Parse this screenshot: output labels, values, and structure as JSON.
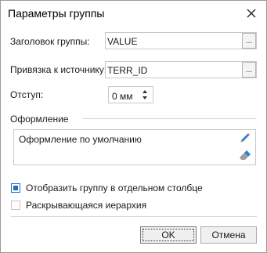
{
  "window": {
    "title": "Параметры группы"
  },
  "form": {
    "group_header": {
      "label": "Заголовок группы:",
      "value": "VALUE",
      "button": "..."
    },
    "source_binding": {
      "label": "Привязка к источнику:",
      "value": "TERR_ID",
      "button": "..."
    },
    "indent": {
      "label": "Отступ:",
      "value": "0 мм"
    },
    "design": {
      "group_label": "Оформление",
      "value": "Оформление по умолчанию",
      "edit_icon": "pencil-icon",
      "clear_icon": "eraser-icon"
    },
    "checkboxes": [
      {
        "label": "Отобразить группу в отдельном столбце",
        "checked": true
      },
      {
        "label": "Раскрывающаяся иерархия",
        "checked": false
      }
    ]
  },
  "buttons": {
    "ok": "OK",
    "cancel": "Отмена"
  },
  "colors": {
    "accent": "#1e6fbf"
  }
}
